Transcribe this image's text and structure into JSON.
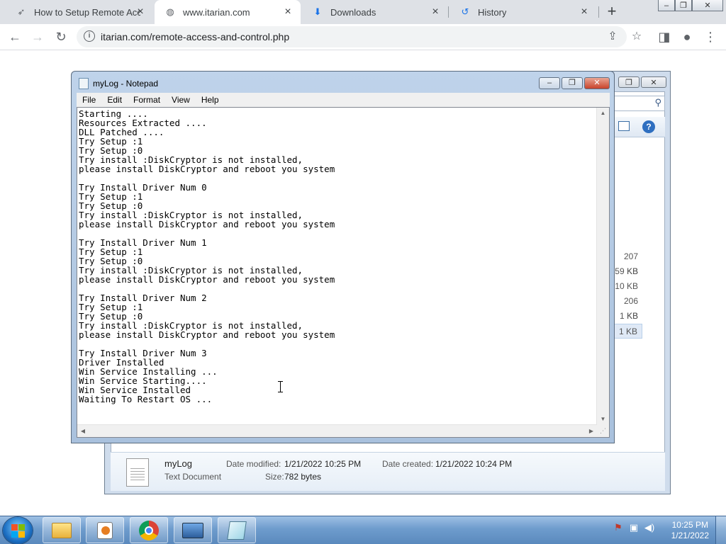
{
  "browser": {
    "tabs": [
      {
        "title": "How to Setup Remote Acce",
        "favicon": "itarian-favicon",
        "active": false
      },
      {
        "title": "www.itarian.com",
        "favicon": "globe-icon",
        "active": true
      },
      {
        "title": "Downloads",
        "favicon": "download-icon",
        "active": false
      },
      {
        "title": "History",
        "favicon": "history-icon",
        "active": false
      }
    ],
    "new_tab": "+",
    "url": "itarian.com/remote-access-and-control.php"
  },
  "window_controls": {
    "minimize": "–",
    "restore": "❐",
    "close": "✕"
  },
  "notepad": {
    "title": "myLog - Notepad",
    "menu": [
      "File",
      "Edit",
      "Format",
      "View",
      "Help"
    ],
    "content": "Starting ....\nResources Extracted ....\nDLL Patched ....\nTry Setup :1\nTry Setup :0\nTry install :DiskCryptor is not installed,\nplease install DiskCryptor and reboot you system\n\nTry Install Driver Num 0\nTry Setup :1\nTry Setup :0\nTry install :DiskCryptor is not installed,\nplease install DiskCryptor and reboot you system\n\nTry Install Driver Num 1\nTry Setup :1\nTry Setup :0\nTry install :DiskCryptor is not installed,\nplease install DiskCryptor and reboot you system\n\nTry Install Driver Num 2\nTry Setup :1\nTry Setup :0\nTry install :DiskCryptor is not installed,\nplease install DiskCryptor and reboot you system\n\nTry Install Driver Num 3\nDriver Installed\nWin Service Installing ...\nWin Service Starting....\nWin Service Installed\nWaiting To Restart OS ..."
  },
  "explorer": {
    "sizes": [
      "207 KB",
      "59 KB",
      "10 KB",
      "206 KB",
      "1 KB",
      "1 KB"
    ],
    "details": {
      "name": "myLog",
      "type": "Text Document",
      "modified_label": "Date modified:",
      "modified": "1/21/2022 10:25 PM",
      "created_label": "Date created:",
      "created": "1/21/2022 10:24 PM",
      "size_label": "Size:",
      "size": "782 bytes"
    }
  },
  "taskbar": {
    "time": "10:25 PM",
    "date": "1/21/2022"
  }
}
